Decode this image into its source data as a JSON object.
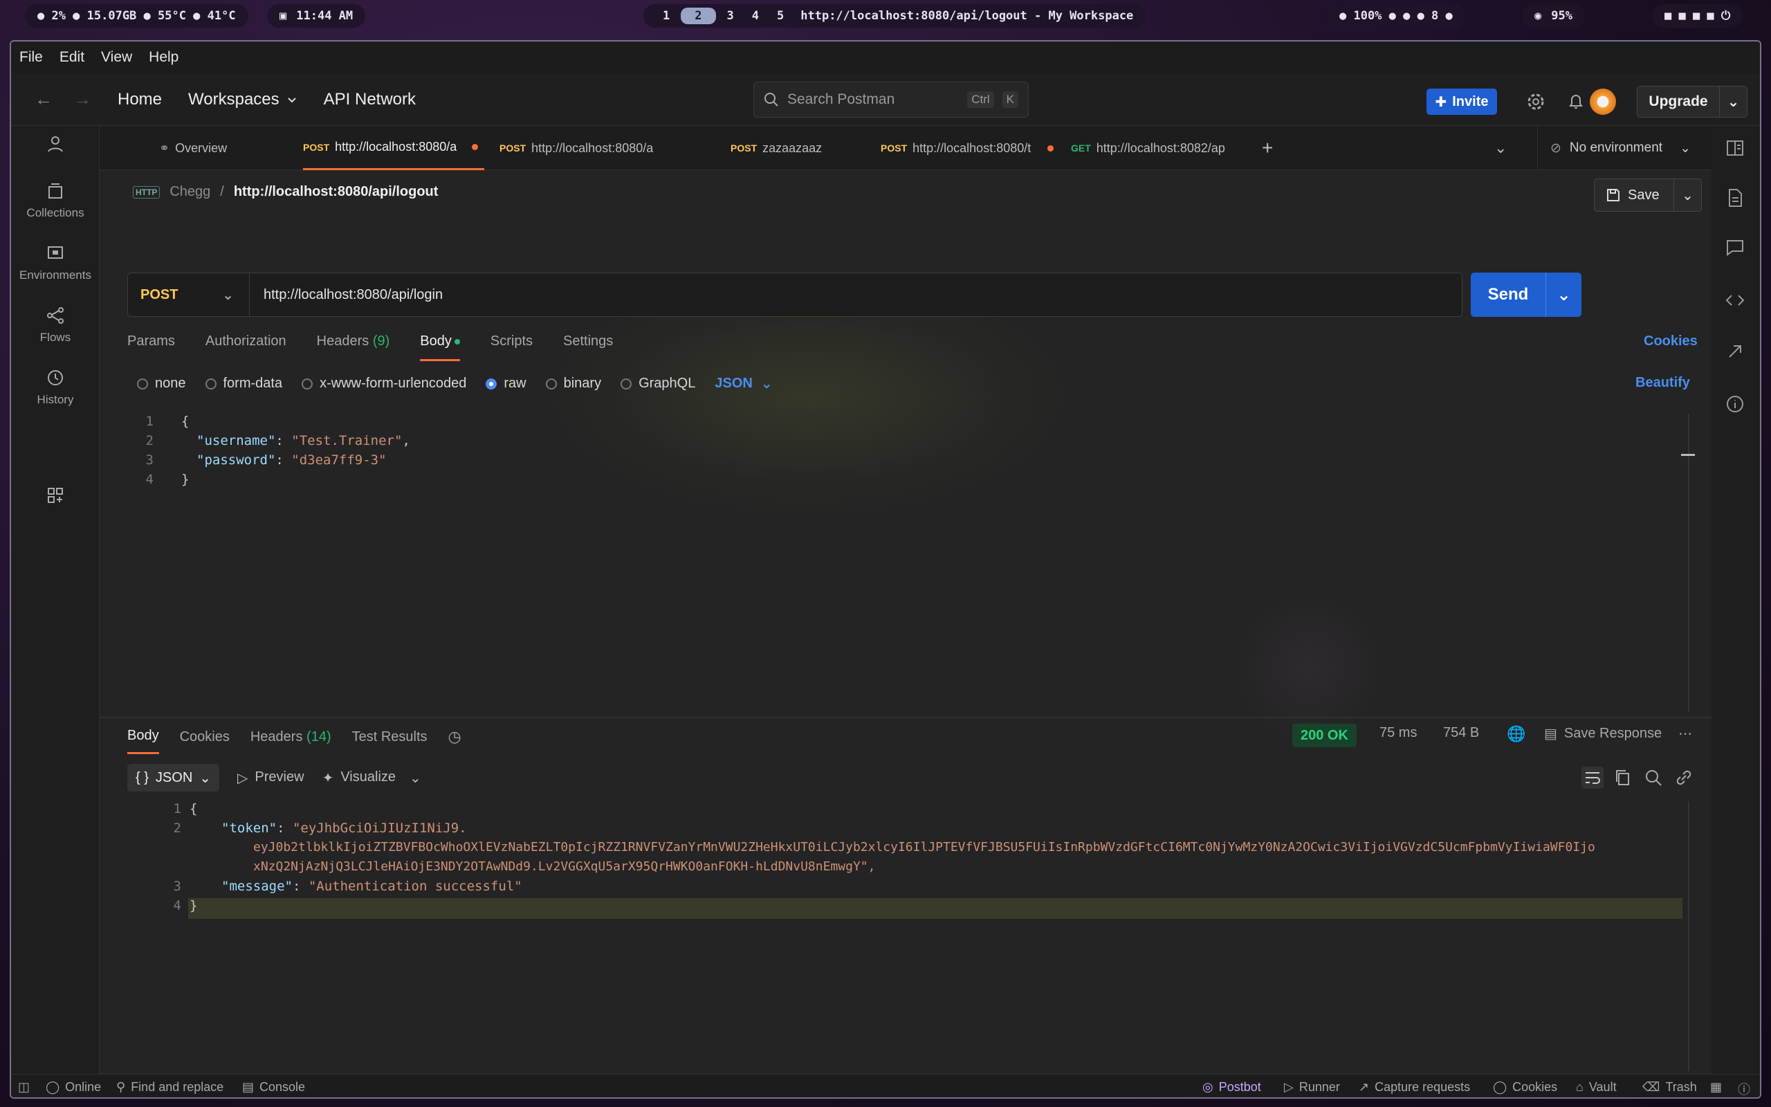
{
  "sysbar": {
    "stats": "● 2%  ● 15.07GB  ● 55°C  ● 41°C",
    "time": "11:44 AM",
    "workspaces": [
      "1",
      "2",
      "3",
      "4",
      "5"
    ],
    "active_workspace": "2",
    "window_title": "http://localhost:8080/api/logout - My Workspace",
    "right_status": "● 100%  ●  ●  ● 8  ●",
    "battery": "95%"
  },
  "menu": [
    "File",
    "Edit",
    "View",
    "Help"
  ],
  "topnav": {
    "home": "Home",
    "workspaces": "Workspaces",
    "api_network": "API Network",
    "search_placeholder": "Search Postman",
    "search_kbd_1": "Ctrl",
    "search_kbd_2": "K",
    "invite": "Invite",
    "upgrade": "Upgrade"
  },
  "sidebar": {
    "collections": "Collections",
    "environments": "Environments",
    "flows": "Flows",
    "history": "History"
  },
  "tabs": [
    {
      "method": "",
      "label": "Overview"
    },
    {
      "method": "POST",
      "label": "http://localhost:8080/a"
    },
    {
      "method": "POST",
      "label": "http://localhost:8080/a"
    },
    {
      "method": "POST",
      "label": "zazaazaaz"
    },
    {
      "method": "POST",
      "label": "http://localhost:8080/t"
    },
    {
      "method": "GET",
      "label": "http://localhost:8082/ap"
    }
  ],
  "environment": "No environment",
  "breadcrumb": {
    "collection": "Chegg",
    "separator": "/",
    "request": "http://localhost:8080/api/logout"
  },
  "save": "Save",
  "request": {
    "method": "POST",
    "url": "http://localhost:8080/api/login",
    "send": "Send"
  },
  "req_tabs": {
    "params": "Params",
    "authorization": "Authorization",
    "headers": "Headers",
    "headers_count": "(9)",
    "body": "Body",
    "scripts": "Scripts",
    "settings": "Settings",
    "cookies": "Cookies"
  },
  "body_options": {
    "none": "none",
    "form_data": "form-data",
    "urlencoded": "x-www-form-urlencoded",
    "raw": "raw",
    "binary": "binary",
    "graphql": "GraphQL",
    "format": "JSON",
    "beautify": "Beautify"
  },
  "request_body": {
    "line_numbers": [
      "1",
      "2",
      "3",
      "4"
    ],
    "open": "{",
    "username_key": "\"username\"",
    "username_val": "\"Test.Trainer\"",
    "password_key": "\"password\"",
    "password_val": "\"d3ea7ff9-3\"",
    "close": "}"
  },
  "response": {
    "tabs": {
      "body": "Body",
      "cookies": "Cookies",
      "headers": "Headers",
      "headers_count": "(14)",
      "test_results": "Test Results"
    },
    "status": "200 OK",
    "time": "75 ms",
    "size": "754 B",
    "save_response": "Save Response",
    "format": "JSON",
    "preview": "Preview",
    "visualize": "Visualize",
    "line_numbers": [
      "1",
      "2",
      "3",
      "4"
    ],
    "open": "{",
    "token_key": "\"token\"",
    "token_line1": "\"eyJhbGciOiJIUzI1NiJ9.",
    "token_line2": "eyJ0b2tlbklkIjoiZTZBVFBOcWhoOXlEVzNabEZLT0pIcjRZZ1RNVFVZanYrMnVWU2ZHeHkxUT0iLCJyb2xlcyI6IlJPTEVfVFJBSU5FUiIsInRpbWVzdGFtcCI6MTc0NjYwMzY0NzA2OCwic3ViIjoiVGVzdC5UcmFpbmVyIiwiaWF0Ijo",
    "token_line3": "xNzQ2NjAzNjQ3LCJleHAiOjE3NDY2OTAwNDd9.Lv2VGGXqU5arX95QrHWKO0anFOKH-hLdDNvU8nEmwgY\",",
    "message_key": "\"message\"",
    "message_val": "\"Authentication successful\"",
    "close": "}"
  },
  "statusbar": {
    "online": "Online",
    "find_replace": "Find and replace",
    "console": "Console",
    "postbot": "Postbot",
    "runner": "Runner",
    "capture": "Capture requests",
    "cookies": "Cookies",
    "vault": "Vault",
    "trash": "Trash"
  },
  "colors": {
    "accent": "#ff6c37",
    "primary": "#1f5fd1",
    "link": "#4b8ef1",
    "method_post": "#ffc857",
    "success": "#2bd17b"
  }
}
